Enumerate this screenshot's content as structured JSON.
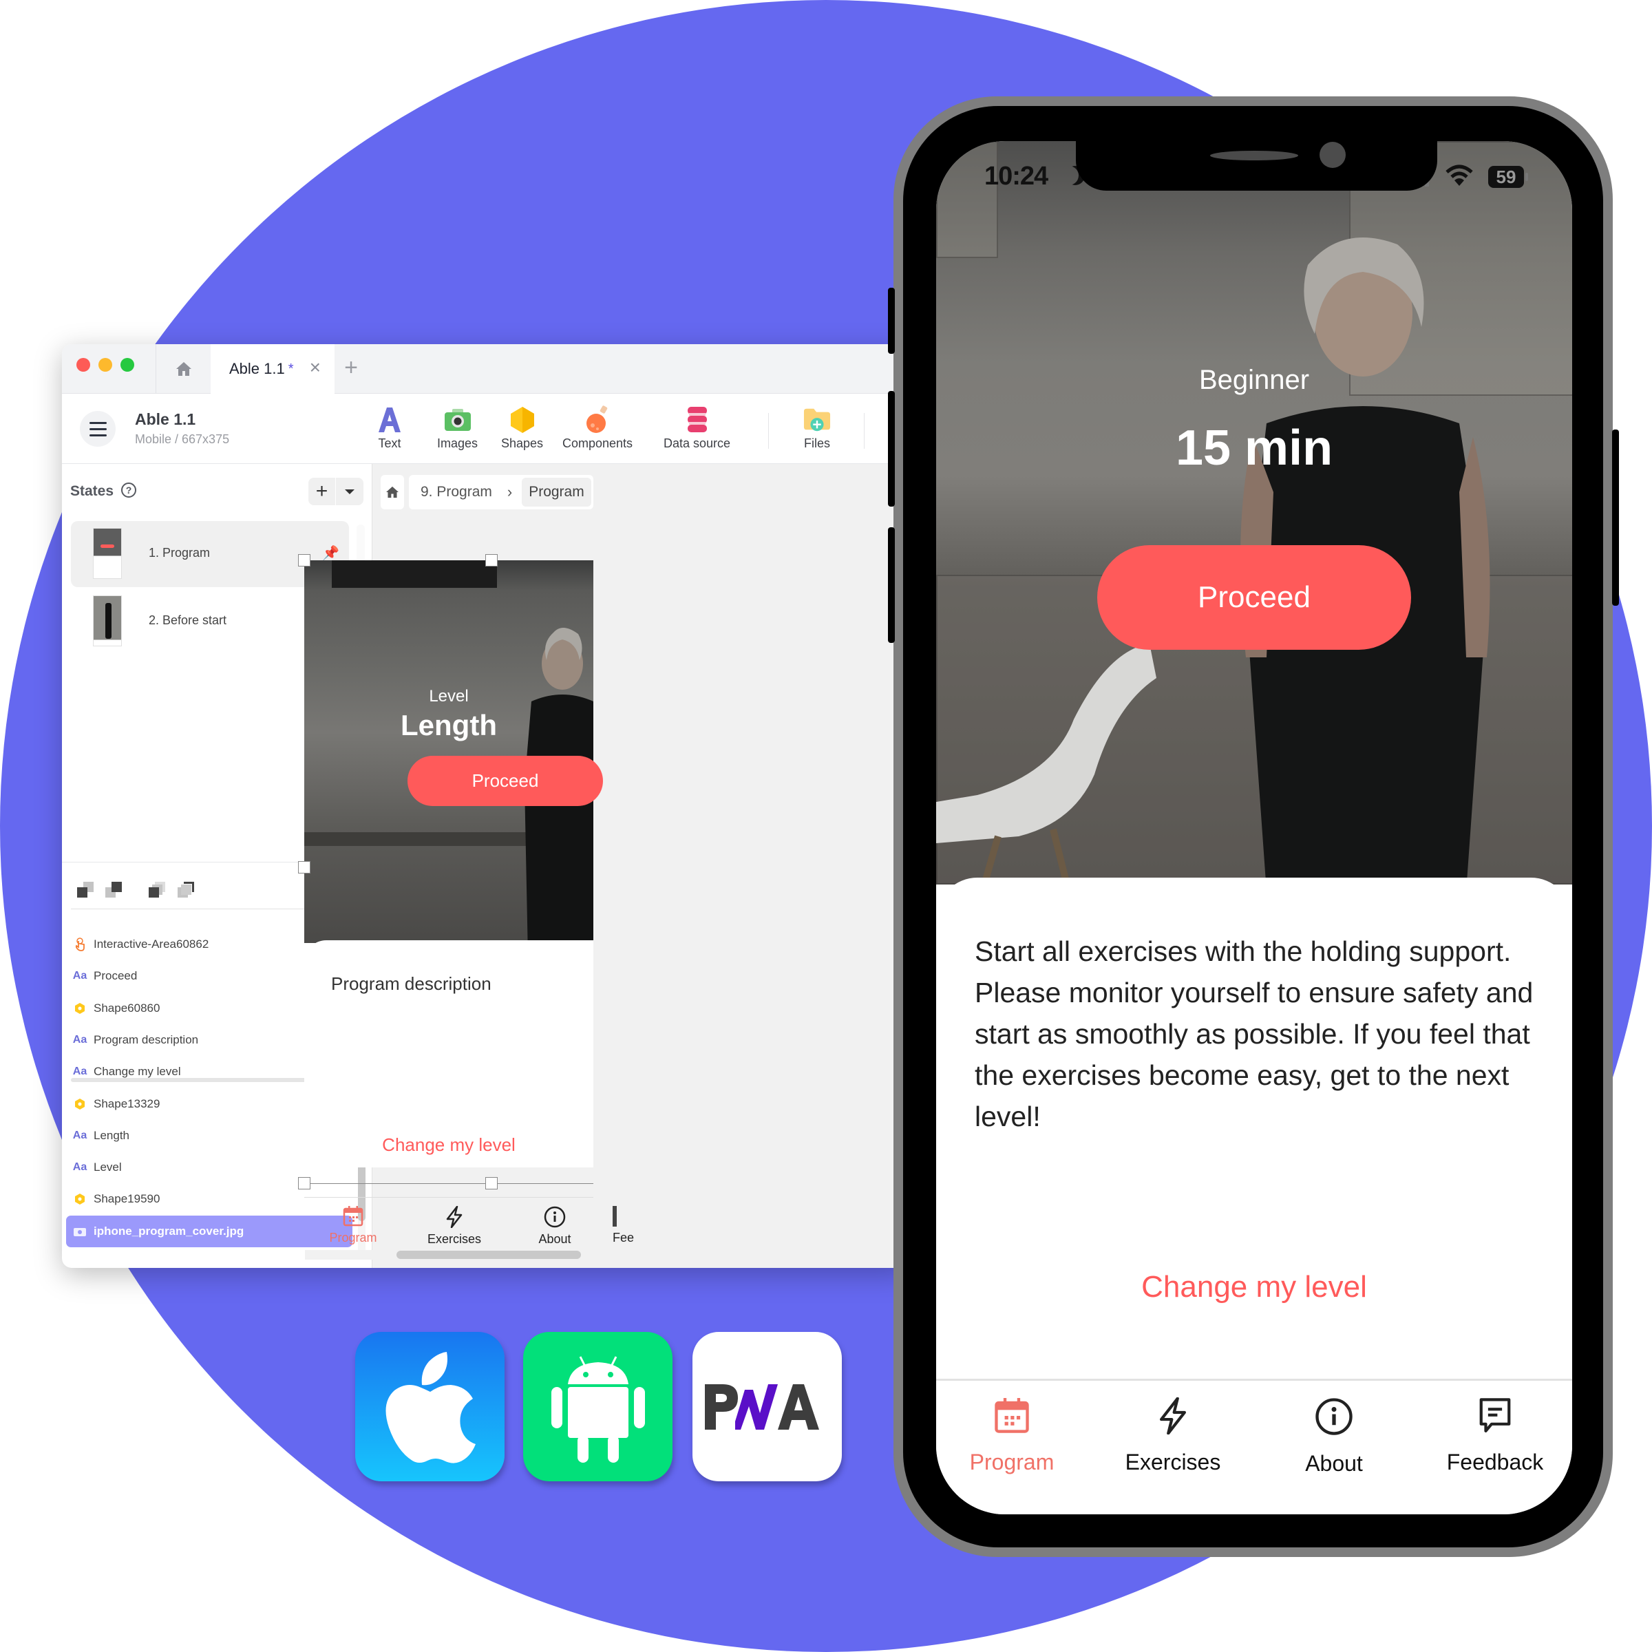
{
  "editor": {
    "tab": {
      "title": "Able 1.1",
      "unsaved_marker": "*"
    },
    "project": {
      "title": "Able 1.1",
      "subtitle": "Mobile / 667x375"
    },
    "toolbar": [
      {
        "label": "Text",
        "icon": "text-icon"
      },
      {
        "label": "Images",
        "icon": "camera-icon"
      },
      {
        "label": "Shapes",
        "icon": "hexagon-icon"
      },
      {
        "label": "Components",
        "icon": "potion-icon"
      },
      {
        "label": "Data source",
        "icon": "database-icon"
      },
      {
        "label": "Files",
        "icon": "folder-add-icon"
      }
    ],
    "states": {
      "title": "States",
      "add_label": "+",
      "items": [
        {
          "label": "1. Program",
          "active": true,
          "pinned": true
        },
        {
          "label": "2. Before start",
          "active": false,
          "pinned": false
        }
      ]
    },
    "layers": [
      {
        "label": "Interactive-Area60862",
        "type": "interactive",
        "has_action": true
      },
      {
        "label": "Proceed",
        "type": "text",
        "has_action": false
      },
      {
        "label": "Shape60860",
        "type": "shape",
        "has_action": false
      },
      {
        "label": "Program description",
        "type": "text",
        "has_action": false
      },
      {
        "label": "Change my level",
        "type": "text",
        "has_action": true
      },
      {
        "label": "Shape13329",
        "type": "shape",
        "has_action": false
      },
      {
        "label": "Length",
        "type": "text",
        "has_action": false
      },
      {
        "label": "Level",
        "type": "text",
        "has_action": false
      },
      {
        "label": "Shape19590",
        "type": "shape",
        "has_action": false
      },
      {
        "label": "iphone_program_cover.jpg",
        "type": "image",
        "has_action": false,
        "selected": true
      }
    ],
    "layer_type_glyph": "Aa",
    "breadcrumb": [
      "9. Program",
      "Program"
    ],
    "artboard": {
      "level": "Level",
      "length": "Length",
      "proceed": "Proceed",
      "description": "Program description",
      "change_level": "Change my level",
      "nav": [
        {
          "label": "Program",
          "active": true
        },
        {
          "label": "Exercises",
          "active": false
        },
        {
          "label": "About",
          "active": false
        },
        {
          "label": "Fee",
          "active": false
        }
      ]
    }
  },
  "phone": {
    "status": {
      "time": "10:24",
      "battery": "59"
    },
    "level": "Beginner",
    "length": "15 min",
    "proceed": "Proceed",
    "description": "Start all exercises with the holding support. Please monitor yourself to ensure safety and start as smoothly as possible. If you feel that the exercises become easy, get to the next level!",
    "change_level": "Change my level",
    "nav": [
      {
        "label": "Program",
        "icon": "calendar-icon",
        "active": true
      },
      {
        "label": "Exercises",
        "icon": "lightning-icon",
        "active": false
      },
      {
        "label": "About",
        "icon": "info-icon",
        "active": false
      },
      {
        "label": "Feedback",
        "icon": "feedback-icon",
        "active": false
      }
    ]
  },
  "platforms": [
    "iOS",
    "Android",
    "PWA"
  ],
  "colors": {
    "background_circle": "#6568f0",
    "accent_red": "#ff5a5a",
    "nav_active": "#f07167",
    "layer_selected": "#9b99fb"
  }
}
